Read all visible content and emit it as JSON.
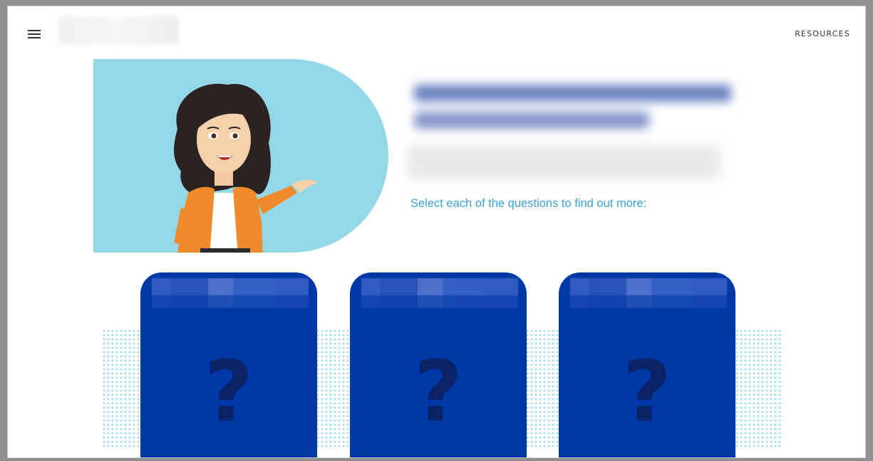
{
  "header": {
    "resources_label": "RESOURCES",
    "menu_icon": "hamburger-menu-icon"
  },
  "intro": {
    "instruction": "Select each of the questions to find out more:"
  },
  "cards": [
    {
      "icon": "question-mark-icon",
      "symbol": "?"
    },
    {
      "icon": "question-mark-icon",
      "symbol": "?"
    },
    {
      "icon": "question-mark-icon",
      "symbol": "?"
    }
  ],
  "colors": {
    "hero_bg": "#94d7e9",
    "card_bg": "#0038a8",
    "instruction_text": "#3aa2d9"
  }
}
